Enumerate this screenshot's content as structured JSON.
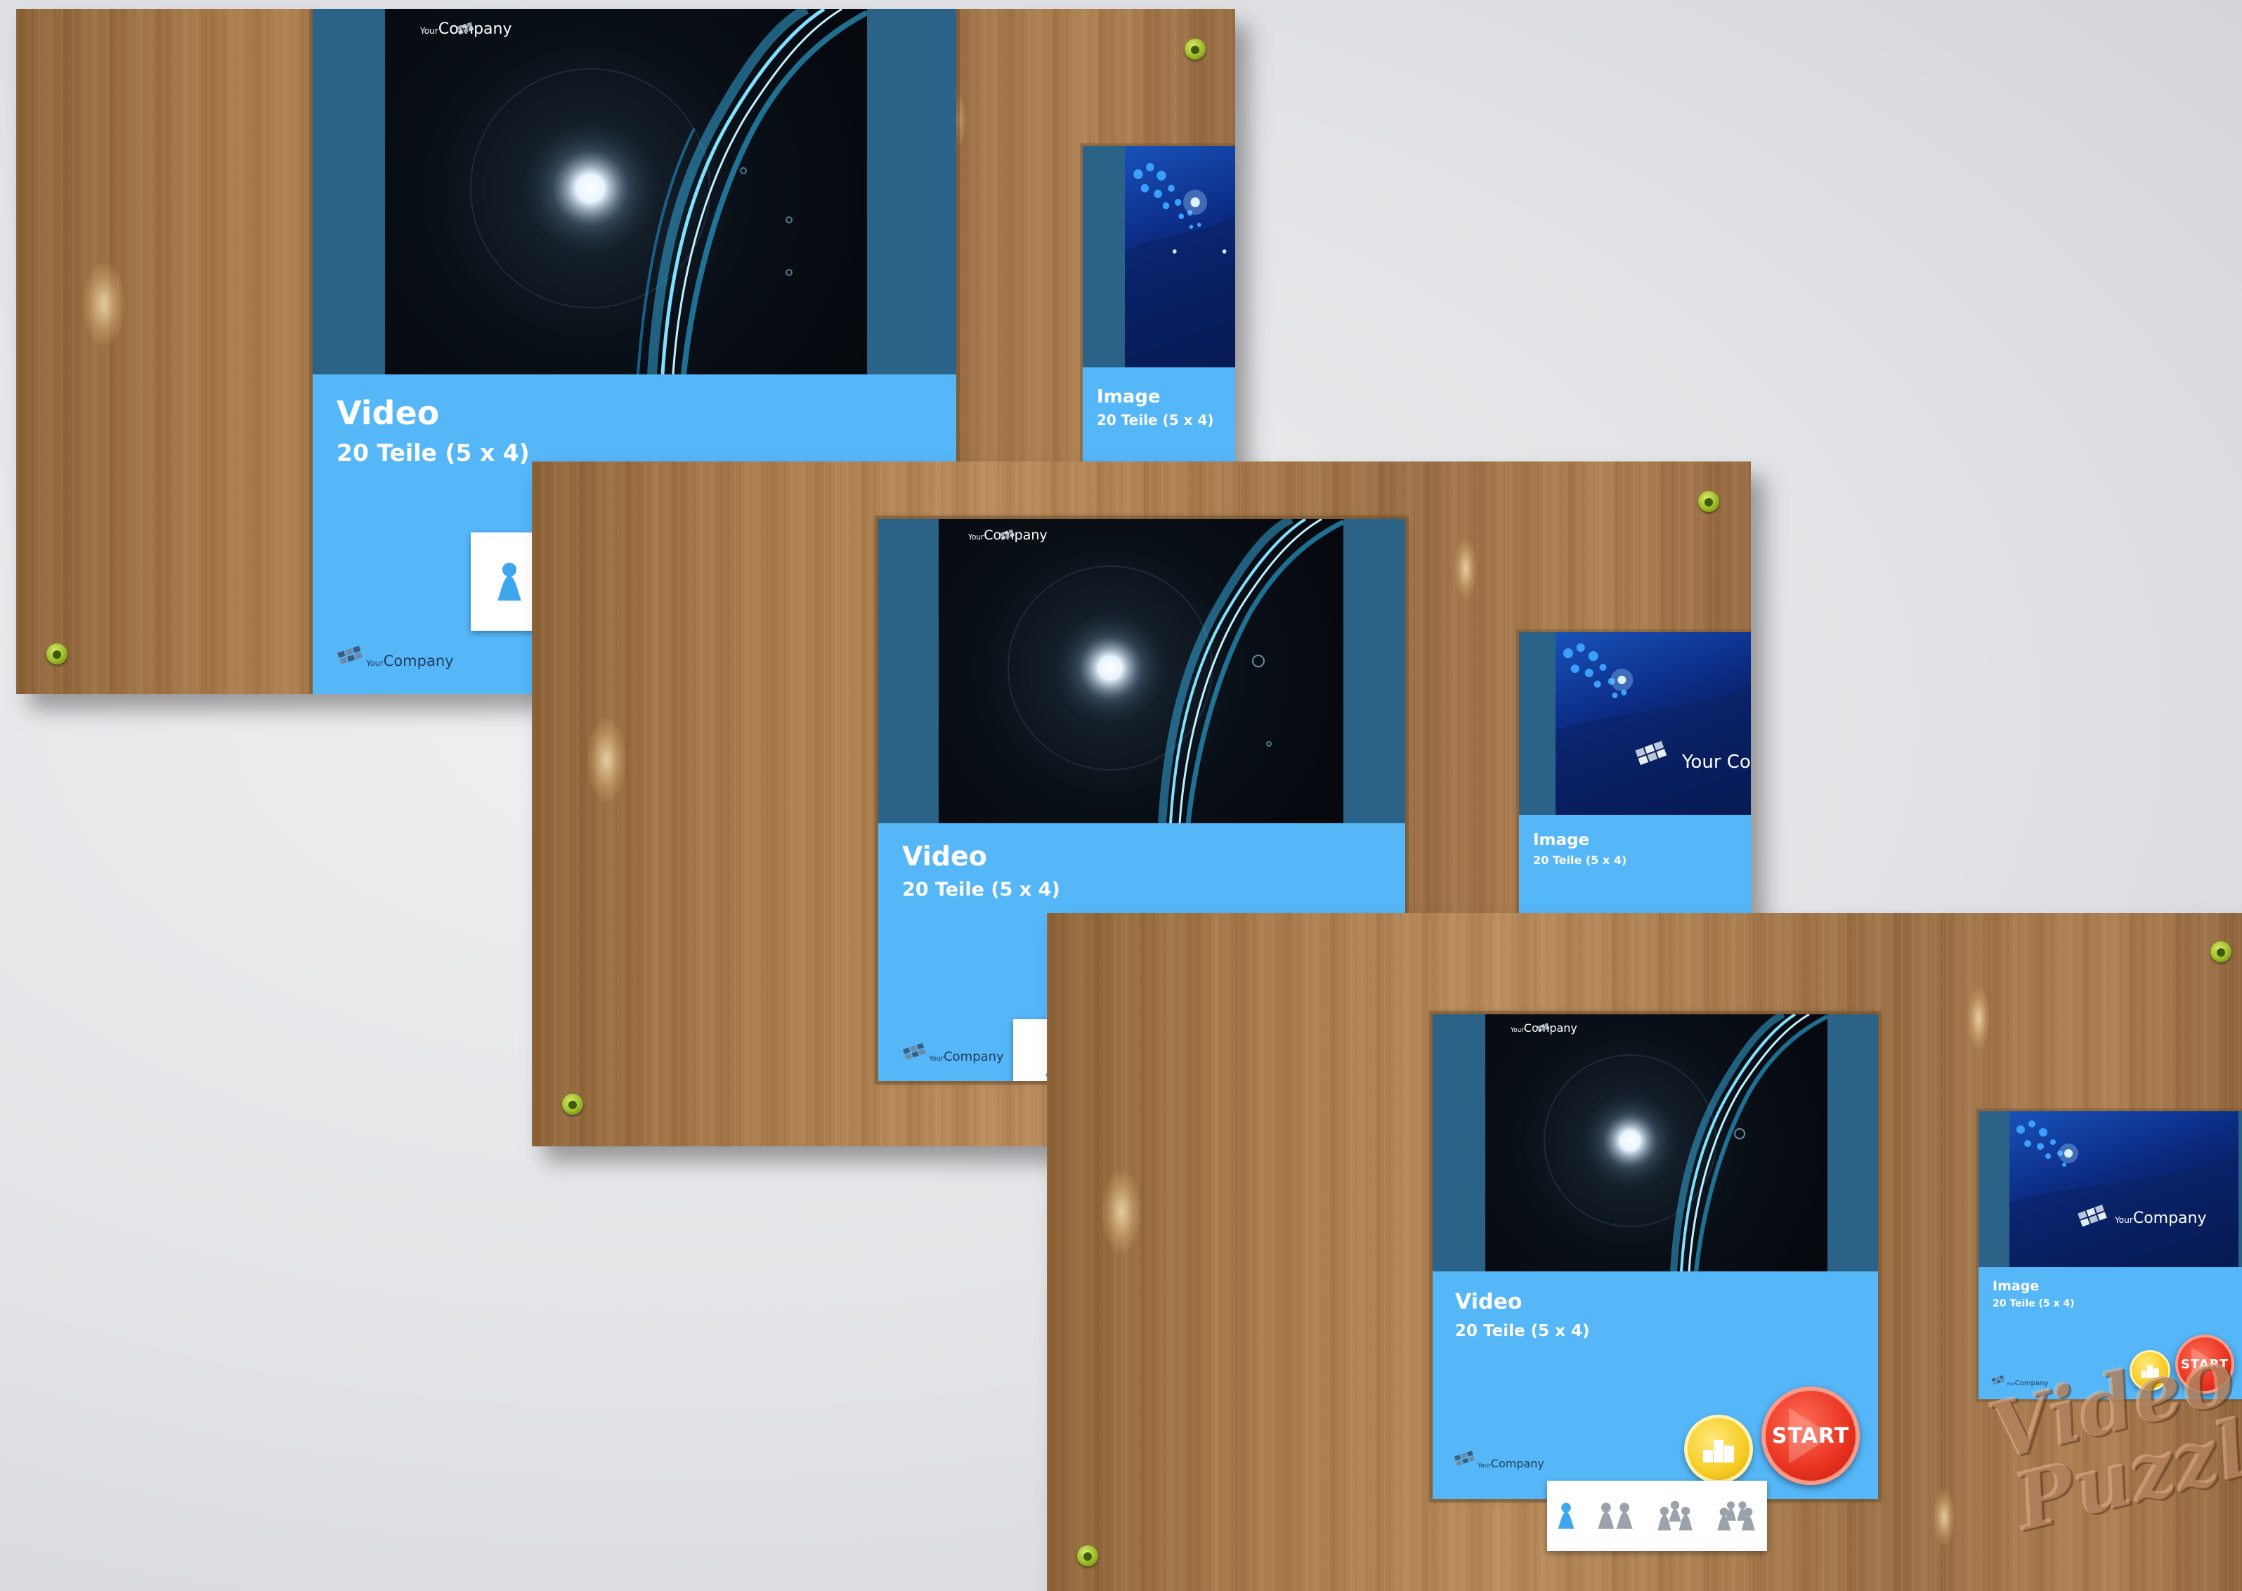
{
  "company": {
    "prefix": "Your",
    "name": "Company"
  },
  "screens": [
    {
      "video_card": {
        "title": "Video",
        "subtitle": "20 Teile (5 x 4)"
      },
      "image_card": {
        "title": "Image",
        "subtitle": "20 Teile (5 x 4)"
      }
    },
    {
      "video_card": {
        "title": "Video",
        "subtitle": "20 Teile (5 x 4)"
      },
      "image_card": {
        "title": "Image",
        "subtitle": "20 Teile (5 x 4)",
        "logo_text": "Your Comp"
      }
    },
    {
      "video_card": {
        "title": "Video",
        "subtitle": "20 Teile (5 x 4)"
      },
      "image_card": {
        "title": "Image",
        "subtitle": "20 Teile (5 x 4)"
      },
      "start_label": "START",
      "small_start_label": "START",
      "player_options": [
        "1 player",
        "2 players",
        "3 players",
        "4 players"
      ]
    }
  ],
  "brand_watermark": {
    "line1": "Video",
    "line2": "Puzzle"
  },
  "colors": {
    "card_blue": "#55b6f8",
    "card_dark": "#2b6287",
    "start_red": "#e8331f",
    "stats_yellow": "#f6cc25",
    "screw_green": "#9cbb28"
  },
  "icons": [
    "pawn-icon",
    "podium-icon",
    "play-icon",
    "company-logo-icon"
  ]
}
